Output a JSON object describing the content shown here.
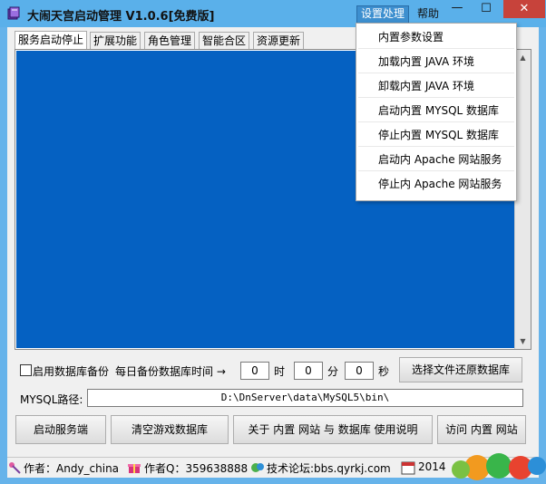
{
  "window": {
    "title": "大闹天宫启动管理 V1.0.6[免费版]",
    "menu_settings": "设置处理",
    "menu_help": "帮助",
    "min_glyph": "—",
    "max_glyph": "☐",
    "close_glyph": "✕"
  },
  "tabs": [
    "服务启动停止",
    "扩展功能",
    "角色管理",
    "智能合区",
    "资源更新"
  ],
  "dropdown": {
    "items": [
      "内置参数设置",
      "加载内置 JAVA 环境",
      "卸载内置 JAVA 环境",
      "启动内置 MYSQL 数据库",
      "停止内置 MYSQL 数据库",
      "启动内 Apache 网站服务",
      "停止内 Apache 网站服务"
    ]
  },
  "backup": {
    "checkbox_label": "启用数据库备份",
    "daily_label": "每日备份数据库时间 →",
    "hour_value": "0",
    "hour_unit": "时",
    "minute_value": "0",
    "minute_unit": "分",
    "second_value": "0",
    "second_unit": "秒",
    "restore_button": "选择文件还原数据库"
  },
  "mysql": {
    "label": "MYSQL路径:",
    "path": "D:\\DnServer\\data\\MySQL5\\bin\\"
  },
  "buttons": {
    "start_server": "启动服务端",
    "clear_db": "清空游戏数据库",
    "about": "关于 内置 网站 与 数据库 使用说明",
    "visit": "访问 内置 网站"
  },
  "status": {
    "author": "作者：Andy_china",
    "qq": "作者Q：359638888",
    "forum": "技术论坛:bbs.qyrkj.com",
    "date_partial": "2014"
  },
  "colors": {
    "titlebar": "#5ab0ea",
    "blue_panel": "#0561c2",
    "close_button": "#c7433b"
  }
}
